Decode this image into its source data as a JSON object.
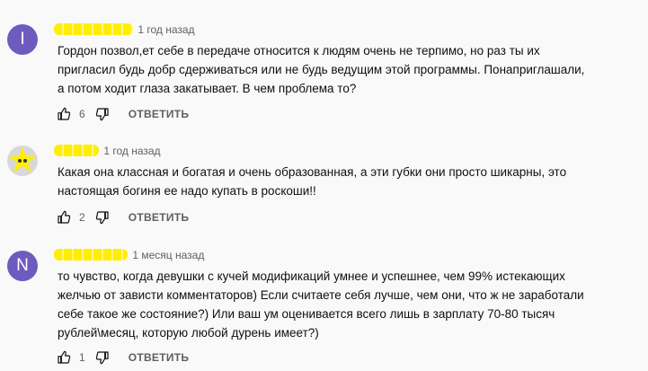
{
  "comments": [
    {
      "avatar_letter": "I",
      "avatar_color": "#6e5bbf",
      "time": "1 год назад",
      "lines": [
        "Гордон позвол,ет себе в передаче относится к людям очень не терпимо, но раз ты их",
        "пригласил будь добр сдерживаться или не будь ведущим этой программы. Понаприглашали,",
        "а потом ходит глаза закатывает. В чем проблема то?"
      ],
      "likes": "6",
      "reply_label": "ОТВЕТИТЬ"
    },
    {
      "avatar_letter": "",
      "avatar_color": "#d8d8d8",
      "time": "1 год назад",
      "lines": [
        "Какая она классная и богатая и очень образованная, а эти губки они просто шикарны, это",
        "настоящая богиня ее надо купать в роскоши!!"
      ],
      "likes": "2",
      "reply_label": "ОТВЕТИТЬ"
    },
    {
      "avatar_letter": "N",
      "avatar_color": "#6e5bbf",
      "time": "1 месяц назад",
      "lines": [
        "то чувство, когда девушки с кучей модификаций умнее и успешнее, чем 99% истекающих",
        "желчью от зависти комментаторов) Если считаете себя лучше, чем они, что ж не заработали",
        "себе такое же состояние?) Или ваш ум оценивается всего лишь в зарплату 70-80 тысяч",
        "рублей\\месяц, которую любой дурень имеет?)"
      ],
      "likes": "1",
      "reply_label": "ОТВЕТИТЬ"
    }
  ],
  "icons": {
    "like": "thumbs-up-icon",
    "dislike": "thumbs-down-icon"
  },
  "colors": {
    "redaction": "#ffee00"
  }
}
